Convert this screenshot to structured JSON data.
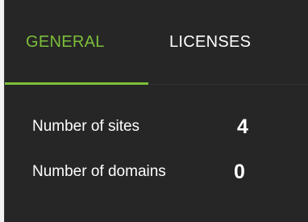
{
  "tabs": {
    "general": "GENERAL",
    "licenses": "LICENSES",
    "active": "general"
  },
  "stats": [
    {
      "label": "Number of sites",
      "value": "4"
    },
    {
      "label": "Number of domains",
      "value": "0"
    }
  ],
  "colors": {
    "panel_background": "#262626",
    "accent": "#7cbf3a",
    "text": "#ffffff"
  }
}
